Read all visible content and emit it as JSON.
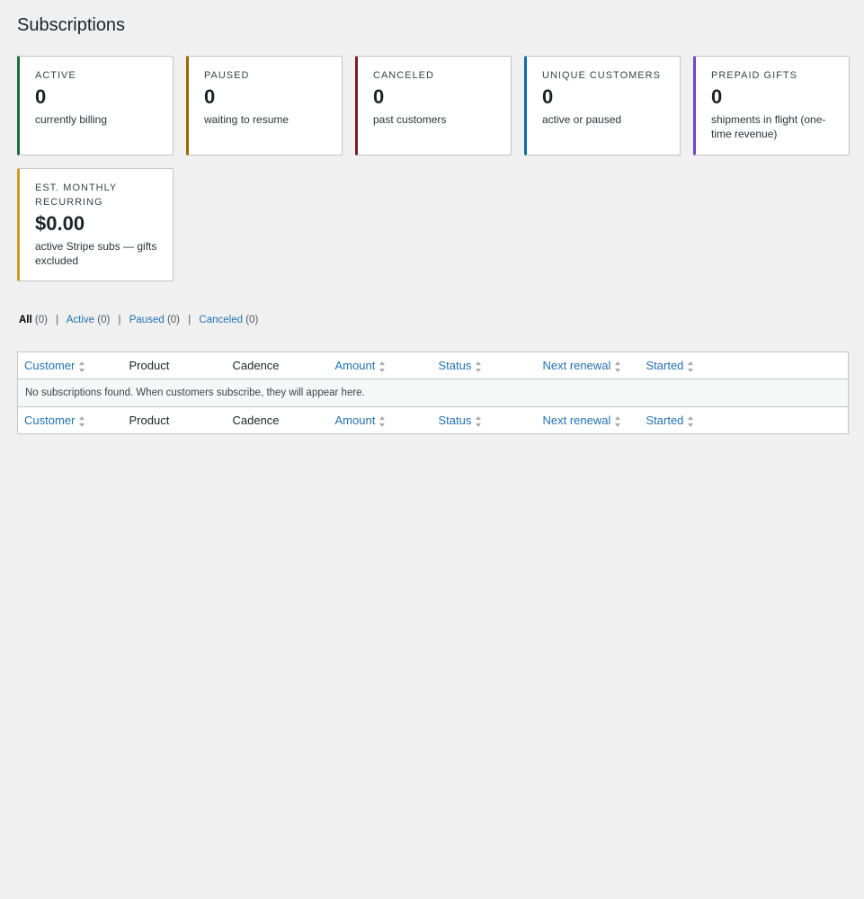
{
  "page": {
    "title": "Subscriptions"
  },
  "stats": [
    {
      "label": "ACTIVE",
      "value": "0",
      "desc": "currently billing",
      "color": "#1e6b37"
    },
    {
      "label": "PAUSED",
      "value": "0",
      "desc": "waiting to resume",
      "color": "#9a6700"
    },
    {
      "label": "CANCELED",
      "value": "0",
      "desc": "past customers",
      "color": "#7a1d22"
    },
    {
      "label": "UNIQUE CUSTOMERS",
      "value": "0",
      "desc": "active or paused",
      "color": "#0a6ea8"
    },
    {
      "label": "PREPAID GIFTS",
      "value": "0",
      "desc": "shipments in flight (one-time revenue)",
      "color": "#7346c1"
    },
    {
      "label": "EST. MONTHLY RECURRING",
      "value": "$0.00",
      "desc": "active Stripe subs — gifts excluded",
      "color": "#d39a22"
    }
  ],
  "filters": [
    {
      "label": "All",
      "count": "(0)"
    },
    {
      "label": "Active",
      "count": "(0)"
    },
    {
      "label": "Paused",
      "count": "(0)"
    },
    {
      "label": "Canceled",
      "count": "(0)"
    }
  ],
  "table": {
    "columns": [
      "Customer",
      "Product",
      "Cadence",
      "Amount",
      "Status",
      "Next renewal",
      "Started"
    ],
    "empty_message": "No subscriptions found. When customers subscribe, they will appear here."
  }
}
